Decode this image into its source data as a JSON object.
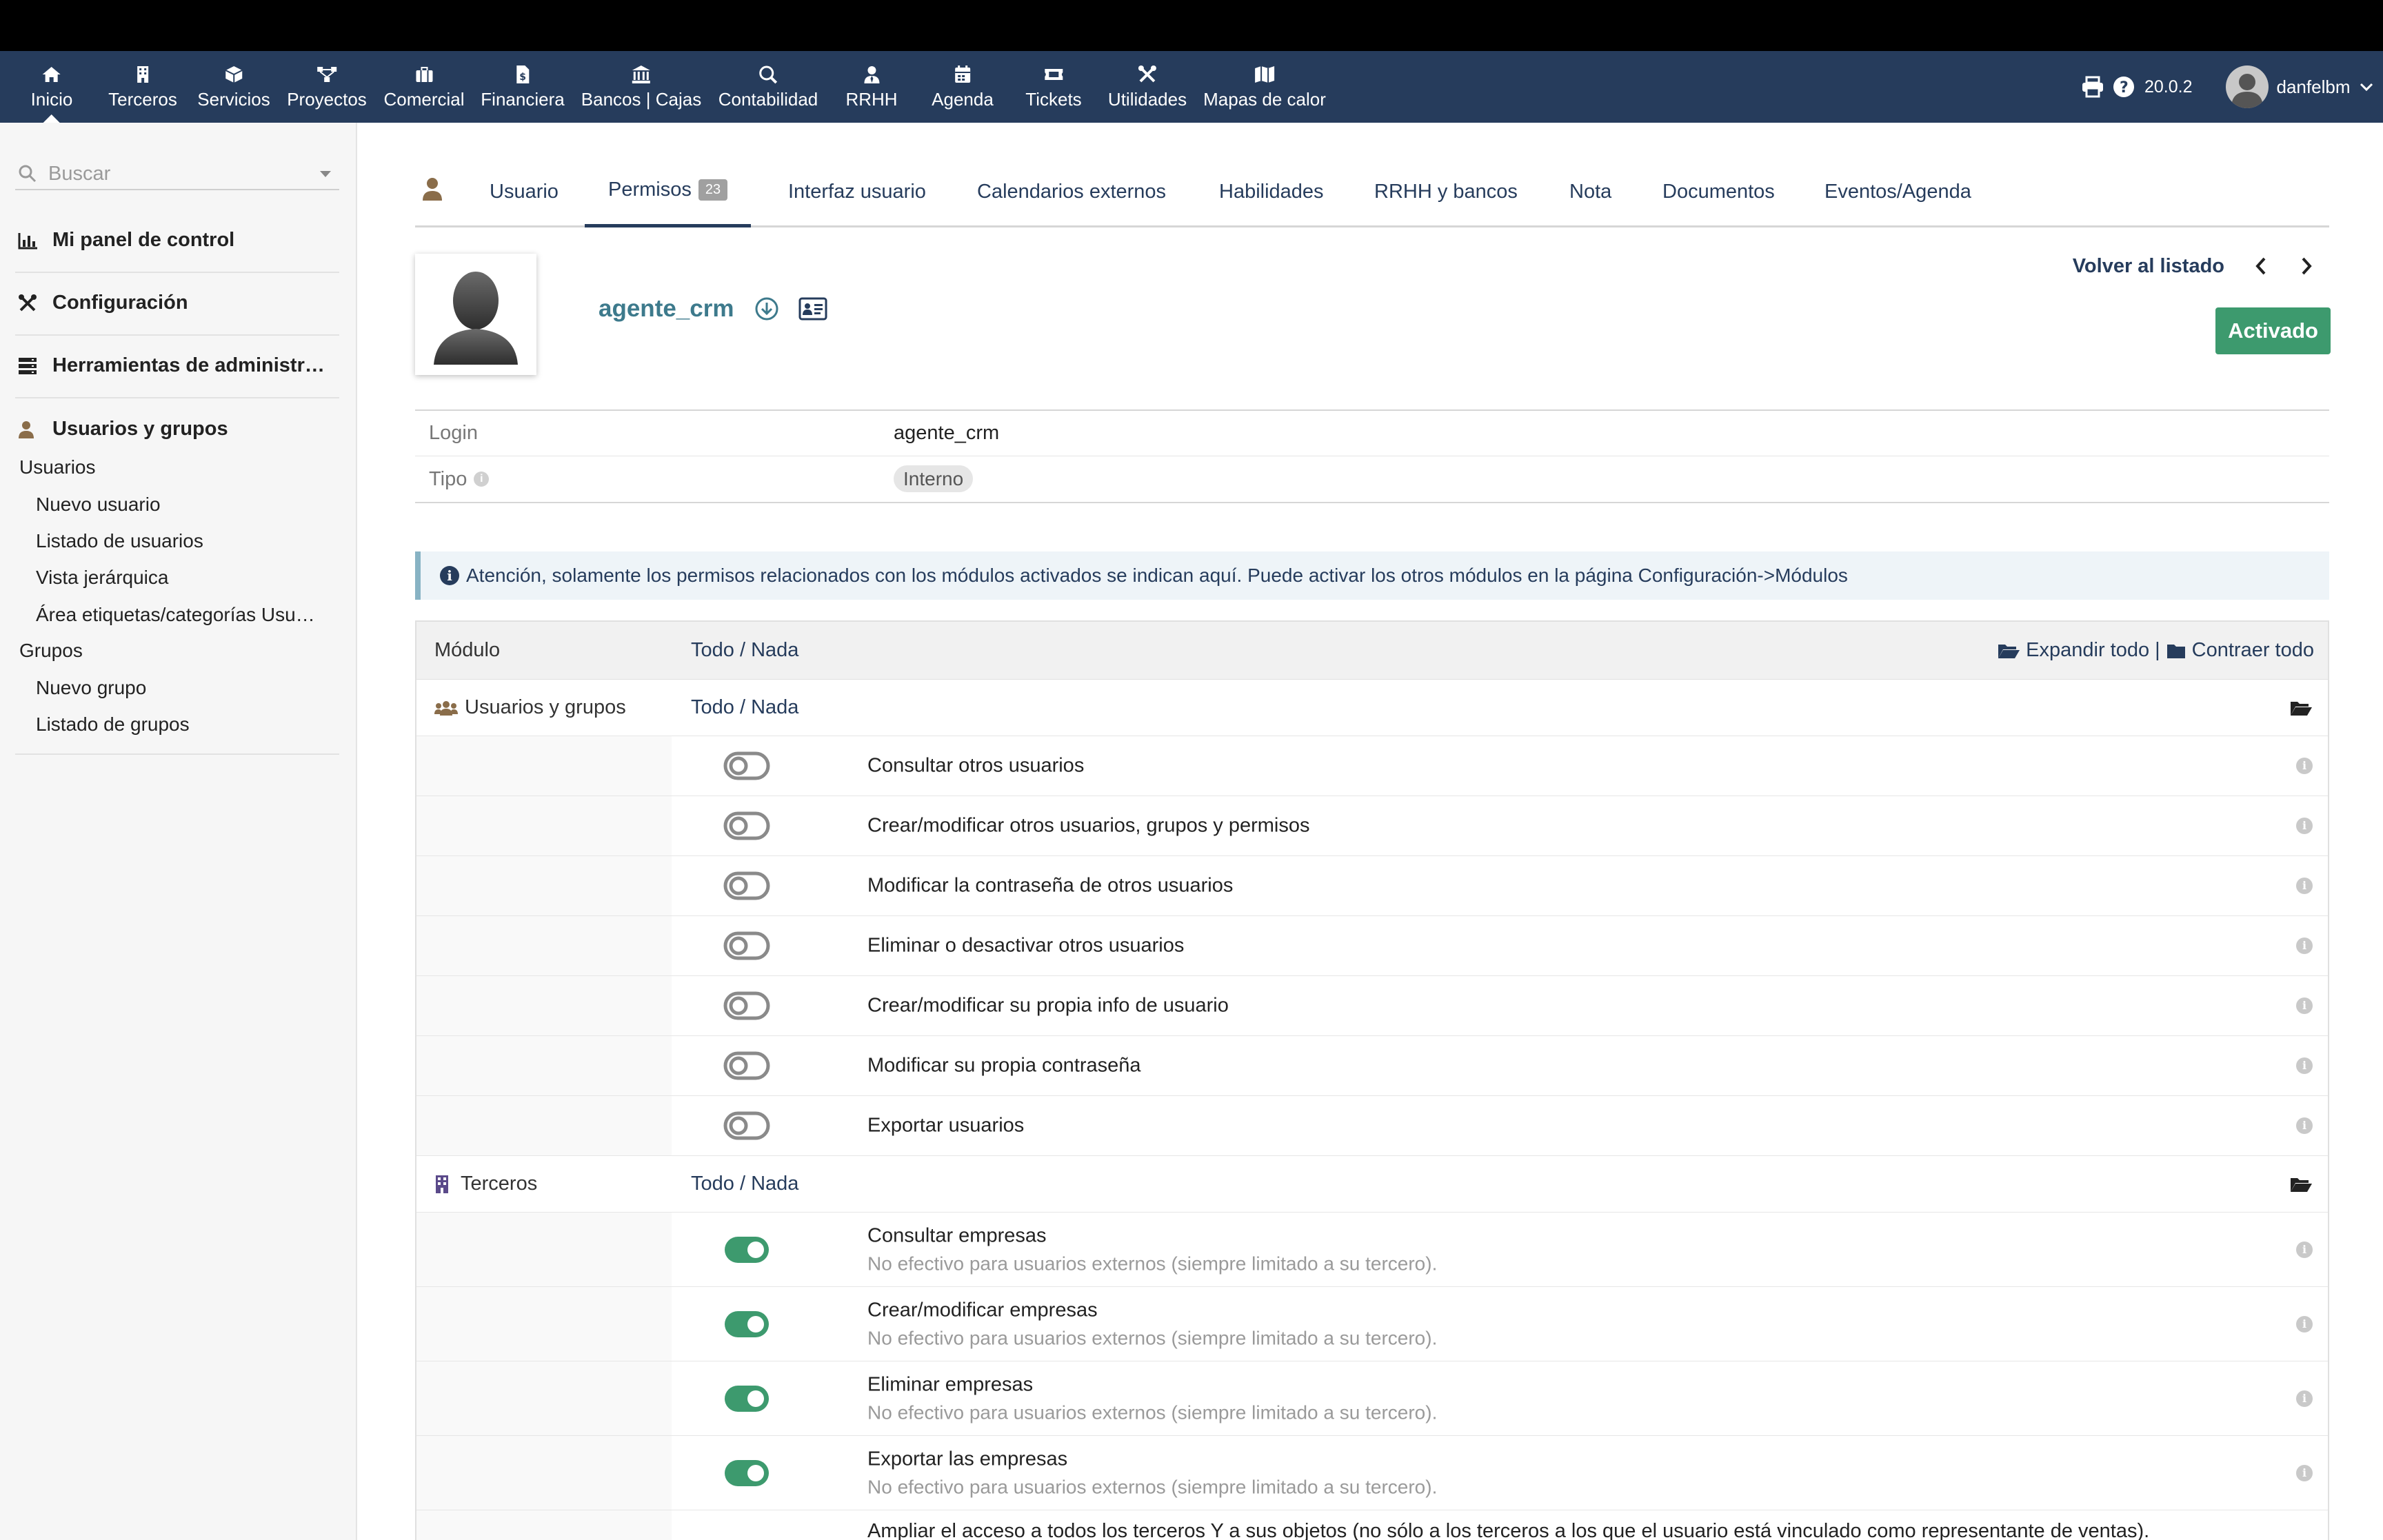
{
  "topnav": {
    "items": [
      {
        "label": "Inicio",
        "icon": "home-icon"
      },
      {
        "label": "Terceros",
        "icon": "building-icon"
      },
      {
        "label": "Servicios",
        "icon": "cube-icon"
      },
      {
        "label": "Proyectos",
        "icon": "sitemap-icon"
      },
      {
        "label": "Comercial",
        "icon": "suitcase-icon"
      },
      {
        "label": "Financiera",
        "icon": "file-invoice-icon"
      },
      {
        "label": "Bancos | Cajas",
        "icon": "bank-icon"
      },
      {
        "label": "Contabilidad",
        "icon": "search-dollar-icon"
      },
      {
        "label": "RRHH",
        "icon": "user-tie-icon"
      },
      {
        "label": "Agenda",
        "icon": "calendar-icon"
      },
      {
        "label": "Tickets",
        "icon": "ticket-icon"
      },
      {
        "label": "Utilidades",
        "icon": "tools-icon"
      },
      {
        "label": "Mapas de calor",
        "icon": "map-icon"
      }
    ],
    "version": "20.0.2",
    "username": "danfelbm"
  },
  "sidebar": {
    "search_placeholder": "Buscar",
    "sections": [
      {
        "label": "Mi panel de control",
        "icon": "chart-icon"
      },
      {
        "label": "Configuración",
        "icon": "tools-icon"
      },
      {
        "label": "Herramientas de administr…",
        "icon": "server-icon"
      },
      {
        "label": "Usuarios y grupos",
        "icon": "user-icon"
      }
    ],
    "links": {
      "usuarios": "Usuarios",
      "nuevo_usuario": "Nuevo usuario",
      "listado_usuarios": "Listado de usuarios",
      "vista_jerarquica": "Vista jerárquica",
      "area_etiquetas": "Área etiquetas/categorías Usu…",
      "grupos": "Grupos",
      "nuevo_grupo": "Nuevo grupo",
      "listado_grupos": "Listado de grupos"
    }
  },
  "tabs": [
    {
      "label": "Usuario"
    },
    {
      "label": "Permisos",
      "badge": "23"
    },
    {
      "label": "Interfaz usuario"
    },
    {
      "label": "Calendarios externos"
    },
    {
      "label": "Habilidades"
    },
    {
      "label": "RRHH y bancos"
    },
    {
      "label": "Nota"
    },
    {
      "label": "Documentos"
    },
    {
      "label": "Eventos/Agenda"
    }
  ],
  "profile": {
    "username": "agente_crm",
    "back_link": "Volver al listado",
    "status": "Activado",
    "status_color": "#3d9a6e"
  },
  "info": {
    "login_label": "Login",
    "login_value": "agente_crm",
    "tipo_label": "Tipo",
    "tipo_value": "Interno"
  },
  "notice": "Atención, solamente los permisos relacionados con los módulos activados se indican aquí. Puede activar los otros módulos en la página Configuración->Módulos",
  "perms": {
    "col_module": "Módulo",
    "todo": "Todo",
    "sep": "/",
    "nada": "Nada",
    "expand_all": "Expandir todo",
    "pipe": "|",
    "collapse_all": "Contraer todo",
    "modules": [
      {
        "name": "Usuarios y grupos",
        "icon": "users-icon",
        "rows": [
          {
            "title": "Consultar otros usuarios",
            "on": false
          },
          {
            "title": "Crear/modificar otros usuarios, grupos y permisos",
            "on": false
          },
          {
            "title": "Modificar la contraseña de otros usuarios",
            "on": false
          },
          {
            "title": "Eliminar o desactivar otros usuarios",
            "on": false
          },
          {
            "title": "Crear/modificar su propia info de usuario",
            "on": false
          },
          {
            "title": "Modificar su propia contraseña",
            "on": false
          },
          {
            "title": "Exportar usuarios",
            "on": false
          }
        ]
      },
      {
        "name": "Terceros",
        "icon": "building-icon",
        "rows": [
          {
            "title": "Consultar empresas",
            "sub": "No efectivo para usuarios externos (siempre limitado a su tercero).",
            "on": true
          },
          {
            "title": "Crear/modificar empresas",
            "sub": "No efectivo para usuarios externos (siempre limitado a su tercero).",
            "on": true
          },
          {
            "title": "Eliminar empresas",
            "sub": "No efectivo para usuarios externos (siempre limitado a su tercero).",
            "on": true
          },
          {
            "title": "Exportar las empresas",
            "sub": "No efectivo para usuarios externos (siempre limitado a su tercero).",
            "on": true
          }
        ]
      }
    ],
    "last_row_text": "Ampliar el acceso a todos los terceros Y a sus objetos (no sólo a los terceros a los que el usuario está vinculado como representante de ventas)."
  }
}
